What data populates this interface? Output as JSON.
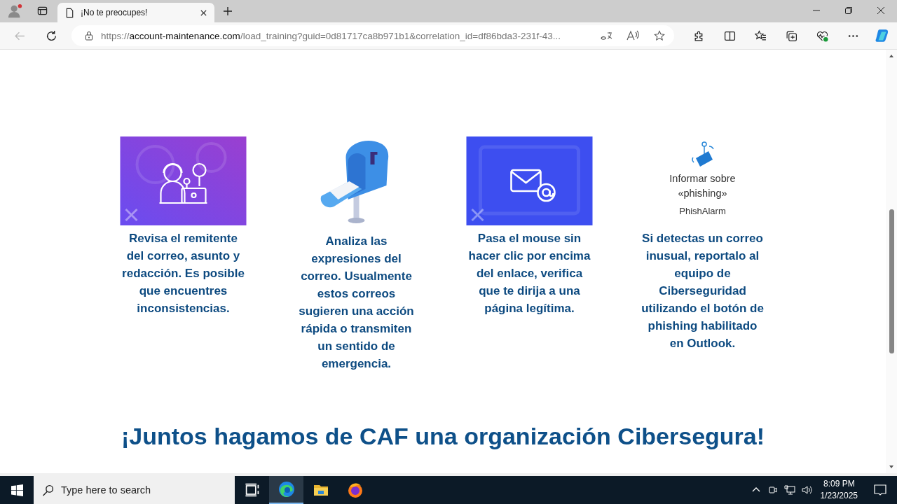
{
  "browser": {
    "tab": {
      "title": "¡No te preocupes!",
      "selected": true
    },
    "address": {
      "scheme": "https://",
      "host": "account-maintenance.com",
      "path": "/load_training?guid=0d81717ca8b971b1&correlation_id=df86bda3-231f-43..."
    }
  },
  "cards": [
    {
      "kind": "agent",
      "text": "Revisa el remitente del correo, asunto y redacción. Es posible que encuentres inconsistencias."
    },
    {
      "kind": "mailbox",
      "text": "Analiza las expresiones del correo. Usualmente estos correos sugieren una acción rápida o transmiten un sentido de emergencia."
    },
    {
      "kind": "email",
      "text": "Pasa el mouse sin hacer clic por encima del enlace, verifica que te dirija a una página legítima."
    },
    {
      "kind": "phishalarm",
      "button_label": "Informar sobre «phishing»",
      "caption": "PhishAlarm",
      "text": "Si detectas un correo inusual, reportalo al equipo de Ciberseguridad utilizando el botón de phishing habilitado en Outlook."
    }
  ],
  "heading": "¡Juntos hagamos de CAF una organización Cibersegura!",
  "taskbar": {
    "search_placeholder": "Type here to search",
    "apps": [
      {
        "kind": "taskview",
        "selected": false
      },
      {
        "kind": "edge",
        "selected": true
      },
      {
        "kind": "explorer",
        "selected": false
      },
      {
        "kind": "firefox",
        "selected": false
      }
    ],
    "time": "8:09 PM",
    "date": "1/23/2025"
  }
}
